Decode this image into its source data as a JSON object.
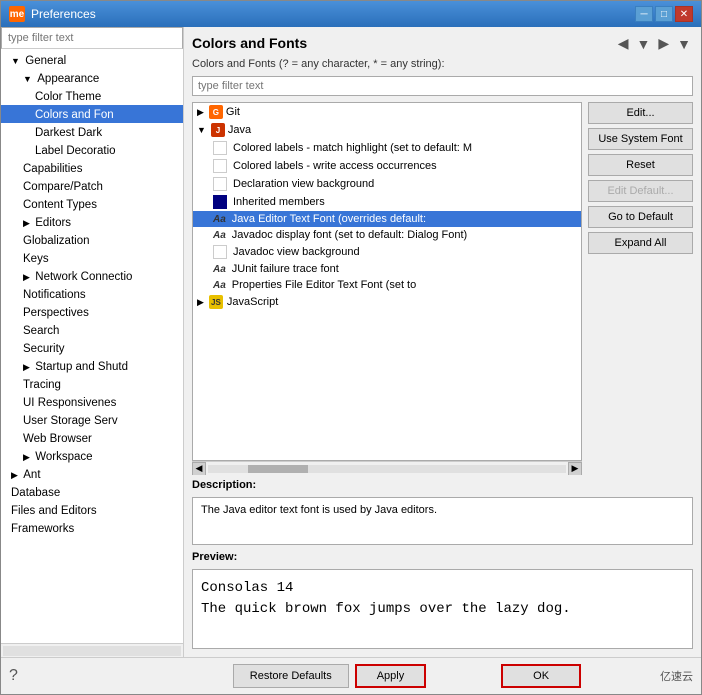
{
  "window": {
    "title": "Preferences",
    "icon": "me"
  },
  "sidebar": {
    "filter_placeholder": "type filter text",
    "items": [
      {
        "id": "general",
        "label": "General",
        "level": 1,
        "expanded": true,
        "triangle": "open"
      },
      {
        "id": "appearance",
        "label": "Appearance",
        "level": 2,
        "expanded": true,
        "triangle": "open"
      },
      {
        "id": "color-theme",
        "label": "Color Theme",
        "level": 3,
        "triangle": "none"
      },
      {
        "id": "colors-and-fonts",
        "label": "Colors and Fon",
        "level": 3,
        "triangle": "none",
        "selected": true
      },
      {
        "id": "darkest-dark",
        "label": "Darkest Dark",
        "level": 3,
        "triangle": "none"
      },
      {
        "id": "label-decorations",
        "label": "Label Decoratio",
        "level": 3,
        "triangle": "none"
      },
      {
        "id": "capabilities",
        "label": "Capabilities",
        "level": 2,
        "triangle": "none"
      },
      {
        "id": "compare-patch",
        "label": "Compare/Patch",
        "level": 2,
        "triangle": "none"
      },
      {
        "id": "content-types",
        "label": "Content Types",
        "level": 2,
        "triangle": "none"
      },
      {
        "id": "editors",
        "label": "Editors",
        "level": 2,
        "triangle": "closed"
      },
      {
        "id": "globalization",
        "label": "Globalization",
        "level": 2,
        "triangle": "none"
      },
      {
        "id": "keys",
        "label": "Keys",
        "level": 2,
        "triangle": "none"
      },
      {
        "id": "network-connections",
        "label": "Network Connectio",
        "level": 2,
        "triangle": "closed"
      },
      {
        "id": "notifications",
        "label": "Notifications",
        "level": 2,
        "triangle": "none"
      },
      {
        "id": "perspectives",
        "label": "Perspectives",
        "level": 2,
        "triangle": "none"
      },
      {
        "id": "search",
        "label": "Search",
        "level": 2,
        "triangle": "none"
      },
      {
        "id": "security",
        "label": "Security",
        "level": 2,
        "triangle": "none"
      },
      {
        "id": "startup-and-shutdown",
        "label": "Startup and Shutd",
        "level": 2,
        "triangle": "closed"
      },
      {
        "id": "tracing",
        "label": "Tracing",
        "level": 2,
        "triangle": "none"
      },
      {
        "id": "ui-responsiveness",
        "label": "UI Responsivenes",
        "level": 2,
        "triangle": "none"
      },
      {
        "id": "user-storage",
        "label": "User Storage Serv",
        "level": 2,
        "triangle": "none"
      },
      {
        "id": "web-browser",
        "label": "Web Browser",
        "level": 2,
        "triangle": "none"
      },
      {
        "id": "workspace",
        "label": "Workspace",
        "level": 2,
        "triangle": "closed"
      },
      {
        "id": "ant",
        "label": "Ant",
        "level": 1,
        "triangle": "closed"
      },
      {
        "id": "database",
        "label": "Database",
        "level": 1,
        "triangle": "none"
      },
      {
        "id": "files-and-editors",
        "label": "Files and Editors",
        "level": 1,
        "triangle": "none"
      },
      {
        "id": "frameworks",
        "label": "Frameworks",
        "level": 1,
        "triangle": "none"
      }
    ]
  },
  "main": {
    "title": "Colors and Fonts",
    "subtitle": "Colors and Fonts (? = any character, * = any string):",
    "filter_placeholder": "type filter text",
    "nav_back_tooltip": "Back",
    "nav_forward_tooltip": "Forward",
    "tree_items": [
      {
        "id": "git",
        "label": "Git",
        "icon": "git",
        "level": 1,
        "triangle": "closed"
      },
      {
        "id": "java",
        "label": "Java",
        "icon": "java",
        "level": 1,
        "triangle": "open"
      },
      {
        "id": "colored-labels-match",
        "label": "Colored labels - match highlight (set to default: M",
        "icon": "blank",
        "level": 2
      },
      {
        "id": "colored-labels-write",
        "label": "Colored labels - write access occurrences",
        "icon": "blank",
        "level": 2
      },
      {
        "id": "declaration-view-bg",
        "label": "Declaration view background",
        "icon": "blank",
        "level": 2
      },
      {
        "id": "inherited-members",
        "label": "Inherited members",
        "icon": "filled",
        "level": 2
      },
      {
        "id": "java-editor-text",
        "label": "Java Editor Text Font (overrides default:",
        "icon": "aa",
        "level": 2,
        "selected": true
      },
      {
        "id": "javadoc-display-font",
        "label": "Javadoc display font (set to default: Dialog Font)",
        "icon": "aa",
        "level": 2
      },
      {
        "id": "javadoc-view-bg",
        "label": "Javadoc view background",
        "icon": "blank",
        "level": 2
      },
      {
        "id": "junit-failure",
        "label": "JUnit failure trace font",
        "icon": "aa",
        "level": 2
      },
      {
        "id": "properties-file",
        "label": "Properties File Editor Text Font (set to",
        "icon": "aa",
        "level": 2
      },
      {
        "id": "javascript",
        "label": "JavaScript",
        "icon": "js",
        "level": 1,
        "triangle": "closed"
      }
    ],
    "buttons": {
      "edit": "Edit...",
      "use_system_font": "Use System Font",
      "reset": "Reset",
      "edit_default": "Edit Default...",
      "go_to_default": "Go to Default",
      "expand_all": "Expand All"
    },
    "description": {
      "label": "Description:",
      "text": "The Java editor text font is used by Java editors."
    },
    "preview": {
      "label": "Preview:",
      "line1": "Consolas 14",
      "line2": "The quick brown fox jumps over the lazy dog."
    },
    "bottom_buttons": {
      "restore_defaults": "Restore Defaults",
      "apply": "Apply",
      "ok": "OK"
    }
  }
}
